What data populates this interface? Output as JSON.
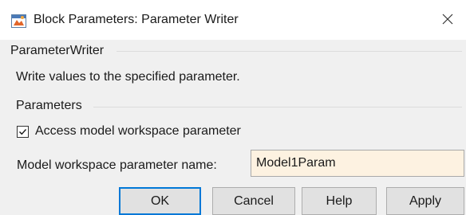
{
  "window": {
    "title": "Block Parameters: Parameter Writer",
    "app_icon": "simulink-block-icon",
    "close_icon": "close-icon"
  },
  "block_section": {
    "header": "ParameterWriter",
    "description": "Write values to the specified parameter."
  },
  "parameters_section": {
    "header": "Parameters",
    "access_checkbox": {
      "label": "Access model workspace parameter",
      "checked": true
    },
    "param_name": {
      "label": "Model workspace parameter name:",
      "value": "Model1Param"
    }
  },
  "buttons": {
    "ok": "OK",
    "cancel": "Cancel",
    "help": "Help",
    "apply": "Apply"
  },
  "colors": {
    "default_button_border": "#0078d7",
    "input_background": "#fdf2e1",
    "panel_background": "#f0f0f0"
  }
}
